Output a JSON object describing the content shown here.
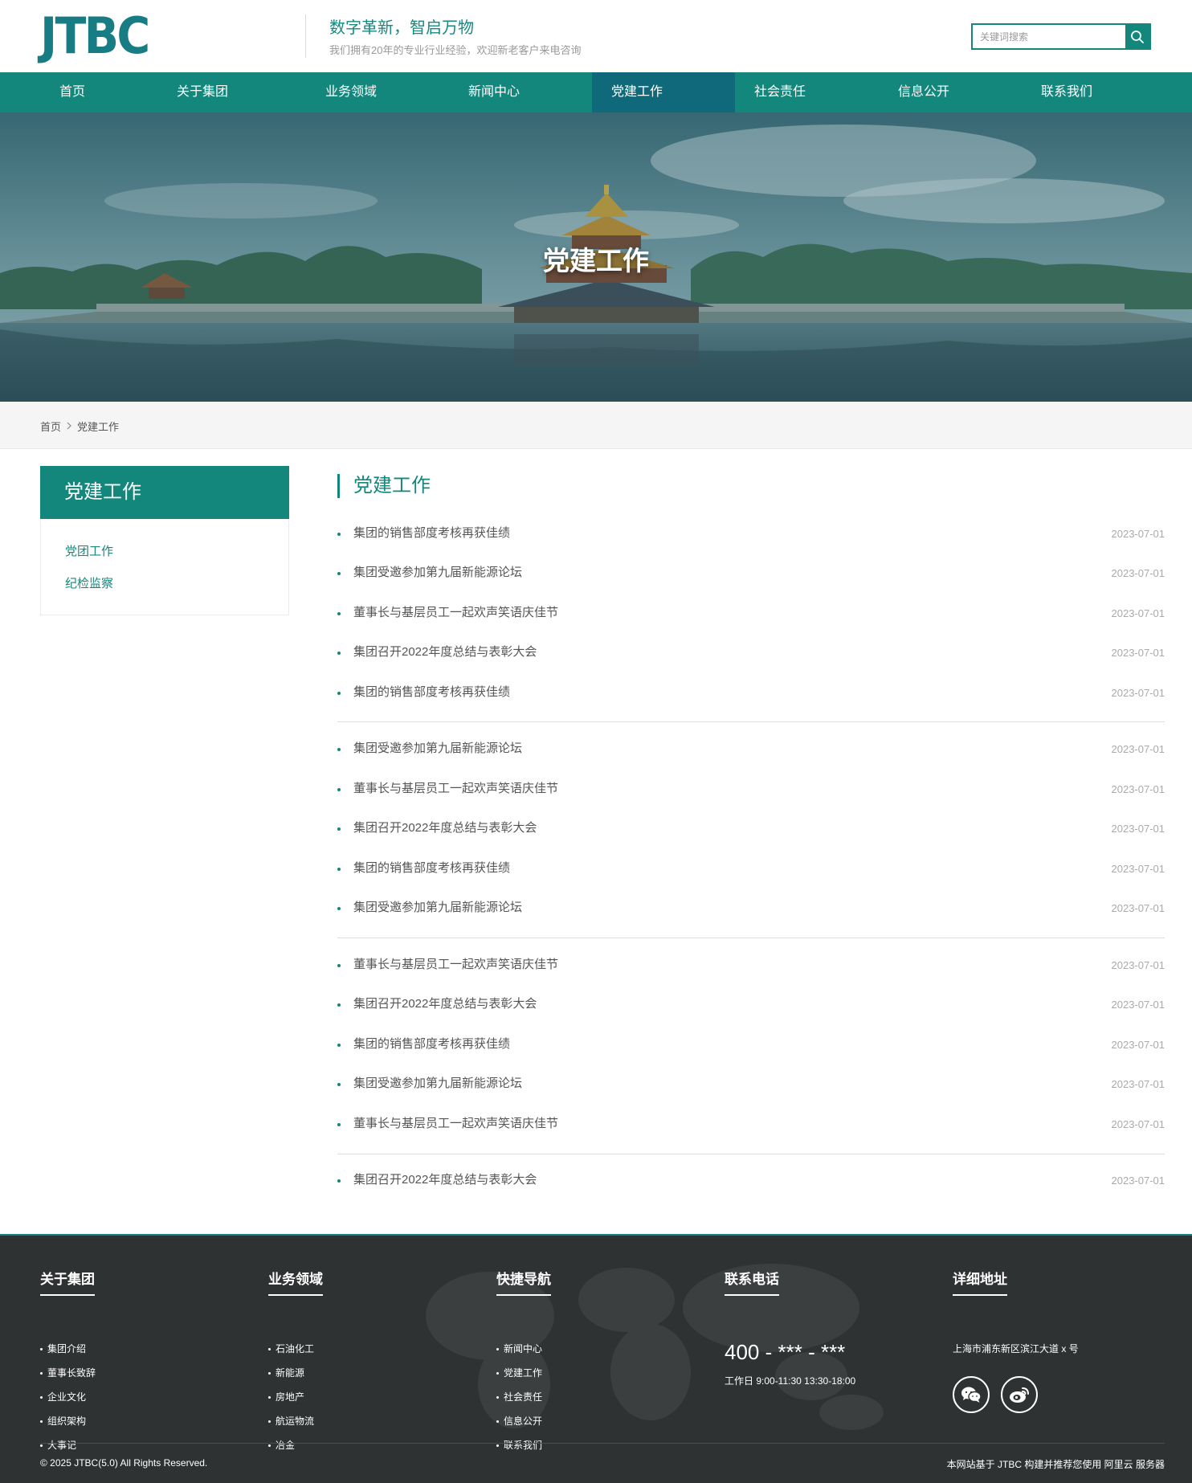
{
  "header": {
    "logo": "JTBC",
    "slogan": "数字革新，智启万物",
    "subslogan": "我们拥有20年的专业行业经验，欢迎新老客户来电咨询",
    "search_placeholder": "关键词搜索"
  },
  "nav": {
    "items": [
      "首页",
      "关于集团",
      "业务领域",
      "新闻中心",
      "党建工作",
      "社会责任",
      "信息公开",
      "联系我们"
    ],
    "active": "党建工作"
  },
  "banner": {
    "title": "党建工作"
  },
  "breadcrumb": {
    "home": "首页",
    "current": "党建工作"
  },
  "sidebar": {
    "title": "党建工作",
    "links": [
      "党团工作",
      "纪检监察"
    ]
  },
  "main": {
    "title": "党建工作",
    "news": [
      {
        "title": "集团的销售部度考核再获佳绩",
        "date": "2023-07-01"
      },
      {
        "title": "集团受邀参加第九届新能源论坛",
        "date": "2023-07-01"
      },
      {
        "title": "董事长与基层员工一起欢声笑语庆佳节",
        "date": "2023-07-01"
      },
      {
        "title": "集团召开2022年度总结与表彰大会",
        "date": "2023-07-01"
      },
      {
        "title": "集团的销售部度考核再获佳绩",
        "date": "2023-07-01"
      },
      {
        "title": "集团受邀参加第九届新能源论坛",
        "date": "2023-07-01"
      },
      {
        "title": "董事长与基层员工一起欢声笑语庆佳节",
        "date": "2023-07-01"
      },
      {
        "title": "集团召开2022年度总结与表彰大会",
        "date": "2023-07-01"
      },
      {
        "title": "集团的销售部度考核再获佳绩",
        "date": "2023-07-01"
      },
      {
        "title": "集团受邀参加第九届新能源论坛",
        "date": "2023-07-01"
      },
      {
        "title": "董事长与基层员工一起欢声笑语庆佳节",
        "date": "2023-07-01"
      },
      {
        "title": "集团召开2022年度总结与表彰大会",
        "date": "2023-07-01"
      },
      {
        "title": "集团的销售部度考核再获佳绩",
        "date": "2023-07-01"
      },
      {
        "title": "集团受邀参加第九届新能源论坛",
        "date": "2023-07-01"
      },
      {
        "title": "董事长与基层员工一起欢声笑语庆佳节",
        "date": "2023-07-01"
      },
      {
        "title": "集团召开2022年度总结与表彰大会",
        "date": "2023-07-01"
      }
    ]
  },
  "footer": {
    "about": {
      "title": "关于集团",
      "links": [
        "集团介绍",
        "董事长致辞",
        "企业文化",
        "组织架构",
        "大事记"
      ]
    },
    "business": {
      "title": "业务领域",
      "links": [
        "石油化工",
        "新能源",
        "房地产",
        "航运物流",
        "冶金"
      ]
    },
    "quick": {
      "title": "快捷导航",
      "links": [
        "新闻中心",
        "党建工作",
        "社会责任",
        "信息公开",
        "联系我们"
      ]
    },
    "contact": {
      "title": "联系电话",
      "phone": "400 - *** - ***",
      "hours": "工作日 9:00-11:30 13:30-18:00"
    },
    "address": {
      "title": "详细地址",
      "text": "上海市浦东新区滨江大道 x 号",
      "icons": [
        "wechat-icon",
        "weibo-icon"
      ]
    },
    "copyright": "© 2025 JTBC(5.0) All Rights Reserved.",
    "powered": "本网站基于 JTBC 构建并推荐您使用 阿里云 服务器"
  },
  "colors": {
    "primary": "#13877c",
    "nav_active": "#10697a",
    "logo": "#177c83",
    "footer_bg": "#2f3233"
  }
}
